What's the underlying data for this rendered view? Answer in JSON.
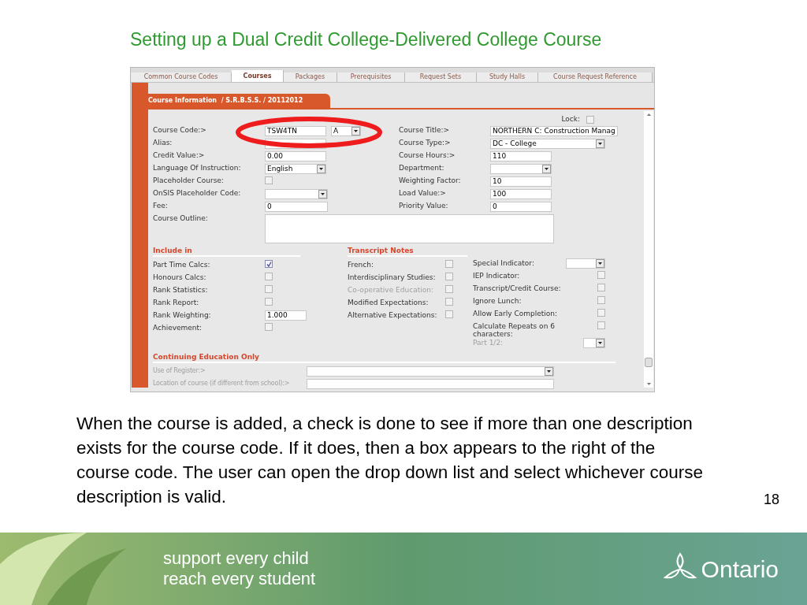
{
  "slide_title": "Setting up a Dual Credit College-Delivered College Course",
  "app": {
    "tabs": [
      {
        "label": "Common Course Codes",
        "selected": false
      },
      {
        "label": "Courses",
        "selected": true
      },
      {
        "label": "Packages",
        "selected": false
      },
      {
        "label": "Prerequisites",
        "selected": false
      },
      {
        "label": "Request Sets",
        "selected": false
      },
      {
        "label": "Study Halls",
        "selected": false
      },
      {
        "label": "Course Request Reference",
        "selected": false
      }
    ],
    "section_tab": "Course Information  / S.R.B.S.S. / 20112012",
    "lock": {
      "label": "Lock:",
      "checked": false
    },
    "left_fields": [
      {
        "label": "Course Code:>",
        "controls": [
          {
            "kind": "text",
            "value": "TSW4TN"
          },
          {
            "kind": "select",
            "value": "A"
          }
        ]
      },
      {
        "label": "Alias:",
        "controls": [
          {
            "kind": "text"
          }
        ]
      },
      {
        "label": "Credit Value:>",
        "controls": [
          {
            "kind": "text",
            "value": "0.00"
          }
        ]
      },
      {
        "label": "Language Of Instruction:",
        "controls": [
          {
            "kind": "select",
            "value": "English"
          }
        ]
      },
      {
        "label": "Placeholder Course:",
        "controls": [
          {
            "kind": "checkbox",
            "checked": false
          }
        ]
      },
      {
        "label": "OnSIS Placeholder Code:",
        "controls": [
          {
            "kind": "select"
          }
        ]
      },
      {
        "label": "Fee:",
        "controls": [
          {
            "kind": "text",
            "value": "0"
          }
        ]
      },
      {
        "label": "Course Outline:",
        "controls": [
          {
            "kind": "textarea"
          }
        ]
      }
    ],
    "right_fields": [
      {
        "label": "Course Title:>",
        "controls": [
          {
            "kind": "text",
            "value": "NORTHERN C: Construction Manag"
          }
        ]
      },
      {
        "label": "Course Type:>",
        "controls": [
          {
            "kind": "select",
            "value": "DC - College"
          }
        ]
      },
      {
        "label": "Course Hours:>",
        "controls": [
          {
            "kind": "text",
            "value": "110"
          }
        ]
      },
      {
        "label": "Department:",
        "controls": [
          {
            "kind": "select"
          }
        ]
      },
      {
        "label": "Weighting Factor:",
        "controls": [
          {
            "kind": "text",
            "value": "10"
          }
        ]
      },
      {
        "label": "Load Value:>",
        "controls": [
          {
            "kind": "text",
            "value": "100"
          }
        ]
      },
      {
        "label": "Priority Value:",
        "controls": [
          {
            "kind": "text",
            "value": "0"
          }
        ]
      }
    ],
    "include_in": {
      "heading": "Include in",
      "rows": [
        {
          "label": "Part Time Calcs:",
          "kind": "checkbox",
          "checked": true,
          "disabled": false
        },
        {
          "label": "Honours Calcs:",
          "kind": "checkbox",
          "checked": false,
          "disabled": false
        },
        {
          "label": "Rank Statistics:",
          "kind": "checkbox",
          "checked": false,
          "disabled": false
        },
        {
          "label": "Rank Report:",
          "kind": "checkbox",
          "checked": false,
          "disabled": false
        },
        {
          "label": "Rank Weighting:",
          "kind": "text",
          "value": "1.000",
          "disabled": false
        },
        {
          "label": "Achievement:",
          "kind": "checkbox",
          "checked": false,
          "disabled": false
        }
      ]
    },
    "transcript_notes": {
      "heading": "Transcript Notes",
      "rows": [
        {
          "label": "French:",
          "kind": "checkbox",
          "checked": false,
          "disabled": false
        },
        {
          "label": "Interdisciplinary Studies:",
          "kind": "checkbox",
          "checked": false,
          "disabled": false
        },
        {
          "label": "Co-operative Education:",
          "kind": "checkbox",
          "checked": false,
          "disabled": true
        },
        {
          "label": "Modified Expectations:",
          "kind": "checkbox",
          "checked": false,
          "disabled": false
        },
        {
          "label": "Alternative Expectations:",
          "kind": "checkbox",
          "checked": false,
          "disabled": false
        }
      ]
    },
    "indicators": [
      {
        "label": "Special Indicator:",
        "kind": "select",
        "disabled": false
      },
      {
        "label": "IEP Indicator:",
        "kind": "checkbox",
        "checked": false,
        "disabled": false
      },
      {
        "label": "Transcript/Credit Course:",
        "kind": "checkbox",
        "checked": false,
        "disabled": false
      },
      {
        "label": "Ignore Lunch:",
        "kind": "checkbox",
        "checked": false,
        "disabled": false
      },
      {
        "label": "Allow Early Completion:",
        "kind": "checkbox",
        "checked": false,
        "disabled": false
      },
      {
        "label": "Calculate Repeats on 6 characters:",
        "kind": "checkbox",
        "checked": false,
        "disabled": false
      },
      {
        "label": "Part 1/2:",
        "kind": "small_select",
        "disabled": true
      }
    ],
    "continuing_education": {
      "heading": "Continuing Education Only",
      "rows": [
        {
          "label": "Use of Register:>",
          "kind": "select",
          "disabled": true
        },
        {
          "label": "Location of course (if different from school):>",
          "kind": "text",
          "disabled": true
        }
      ]
    }
  },
  "body_text": "When the course is added, a check is done to see if more than one description exists for the course code. If it does, then a box appears to the right of the course code. The user can open the drop down list and select whichever course description is valid.",
  "page_number": "18",
  "footer": {
    "tagline": [
      "support every child",
      "reach every student"
    ],
    "logo_text": "Ontario"
  }
}
